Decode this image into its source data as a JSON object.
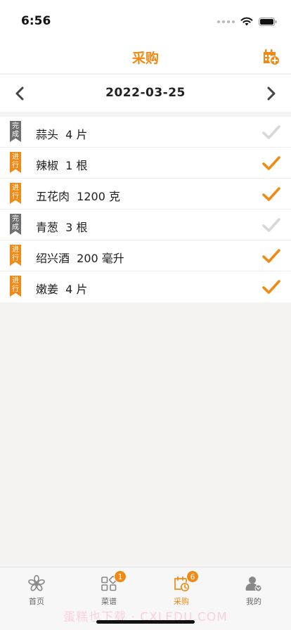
{
  "status_bar": {
    "time": "6:56"
  },
  "nav": {
    "title": "采购"
  },
  "date_bar": {
    "date": "2022-03-25"
  },
  "items": [
    {
      "tag": "完成",
      "tag_state": "done",
      "text": "蒜头  4 片",
      "checked": false
    },
    {
      "tag": "进行",
      "tag_state": "active",
      "text": "辣椒  1 根",
      "checked": true
    },
    {
      "tag": "进行",
      "tag_state": "active",
      "text": "五花肉  1200 克",
      "checked": true
    },
    {
      "tag": "完成",
      "tag_state": "done",
      "text": "青葱  3 根",
      "checked": false
    },
    {
      "tag": "进行",
      "tag_state": "active",
      "text": "绍兴酒  200 毫升",
      "checked": true
    },
    {
      "tag": "进行",
      "tag_state": "active",
      "text": "嫩姜  4 片",
      "checked": true
    }
  ],
  "tabs": [
    {
      "label": "首页",
      "icon": "flower-icon"
    },
    {
      "label": "菜谱",
      "icon": "grid-icon",
      "badge": "1"
    },
    {
      "label": "采购",
      "icon": "calendar-clock-icon",
      "badge": "6",
      "active": true
    },
    {
      "label": "我的",
      "icon": "user-icon"
    }
  ],
  "watermark": "蛋糕也下载 · CXLEDU.COM",
  "colors": {
    "accent": "#f08a14",
    "done_tag": "#6f6f6f",
    "check_inactive": "#d7d7d7"
  }
}
